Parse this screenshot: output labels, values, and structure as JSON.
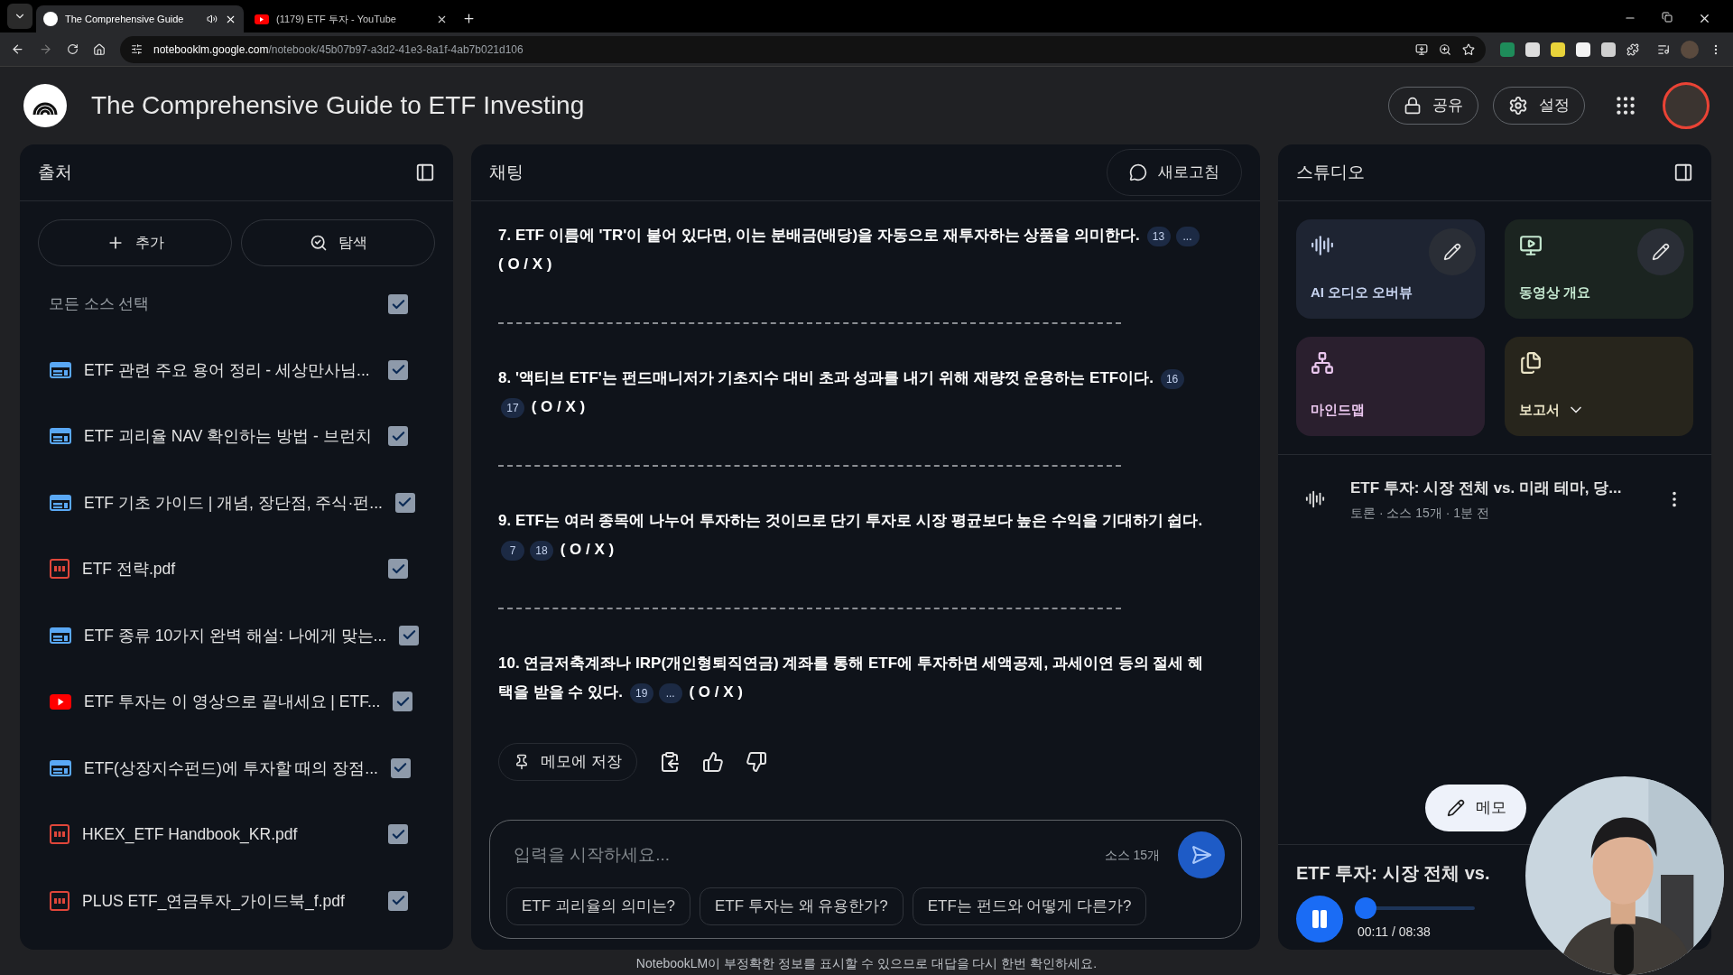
{
  "browser": {
    "tabs": [
      {
        "title": "The Comprehensive Guide",
        "kind": "notebook",
        "selected": true,
        "audio": true
      },
      {
        "title": "(1179) ETF 투자 - YouTube",
        "kind": "youtube",
        "selected": false,
        "audio": false
      }
    ],
    "address": {
      "host": "notebooklm.google.com",
      "path": "/notebook/45b07b97-a3d2-41e3-8a1f-4ab7b021d106"
    }
  },
  "header": {
    "title": "The Comprehensive Guide to ETF Investing",
    "share": "공유",
    "settings": "설정"
  },
  "sources": {
    "title": "출처",
    "add": "추가",
    "explore": "탐색",
    "select_all": {
      "label": "모든 소스 선택",
      "checked": true
    },
    "items": [
      {
        "title": "ETF 관련 주요 용어 정리 - 세상만사님...",
        "kind": "web",
        "checked": true
      },
      {
        "title": "ETF 괴리율 NAV 확인하는 방법 - 브런치",
        "kind": "web",
        "checked": true
      },
      {
        "title": "ETF 기초 가이드 | 개념, 장단점, 주식·펀...",
        "kind": "web",
        "checked": true
      },
      {
        "title": "ETF 전략.pdf",
        "kind": "pdf",
        "checked": true
      },
      {
        "title": "ETF 종류 10가지 완벽 해설: 나에게 맞는...",
        "kind": "web",
        "checked": true
      },
      {
        "title": "ETF 투자는 이 영상으로 끝내세요 | ETF...",
        "kind": "youtube",
        "checked": true
      },
      {
        "title": "ETF(상장지수펀드)에 투자할 때의 장점...",
        "kind": "web",
        "checked": true
      },
      {
        "title": "HKEX_ETF Handbook_KR.pdf",
        "kind": "pdf",
        "checked": true
      },
      {
        "title": "PLUS ETF_연금투자_가이드북_f.pdf",
        "kind": "pdf",
        "checked": true
      }
    ]
  },
  "chat": {
    "title": "채팅",
    "refresh": "새로고침",
    "questions": [
      {
        "text": "7. ETF 이름에 'TR'이 붙어 있다면, 이는 분배금(배당)을 자동으로 재투자하는 상품을 의미한다.",
        "citations": [
          "13",
          "..."
        ],
        "mark": "( O / X )"
      },
      {
        "text": "8. '액티브 ETF'는 펀드매니저가 기초지수 대비 초과 성과를 내기 위해 재량껏 운용하는 ETF이다.",
        "citations": [
          "16",
          "17"
        ],
        "mark": "( O / X )"
      },
      {
        "text": "9. ETF는 여러 종목에 나누어 투자하는 것이므로 단기 투자로 시장 평균보다 높은 수익을 기대하기 쉽다.",
        "citations": [
          "7",
          "18"
        ],
        "mark": "( O / X )"
      },
      {
        "text": "10. 연금저축계좌나 IRP(개인형퇴직연금) 계좌를 통해 ETF에 투자하면 세액공제, 과세이연 등의 절세 혜택을 받을 수 있다.",
        "citations": [
          "19",
          "..."
        ],
        "mark": "( O / X )"
      }
    ],
    "save_note": "메모에 저장",
    "input": {
      "placeholder": "입력을 시작하세요...",
      "source_count": "소스 15개"
    },
    "suggestions": [
      "ETF 괴리율의 의미는?",
      "ETF 투자는 왜 유용한가?",
      "ETF는 펀드와 어떻게 다른가?"
    ]
  },
  "studio": {
    "title": "스튜디오",
    "tiles": [
      {
        "label": "AI 오디오 오버뷰",
        "kind": "audio",
        "editable": true
      },
      {
        "label": "동영상 개요",
        "kind": "video",
        "editable": true
      },
      {
        "label": "마인드맵",
        "kind": "mindmap",
        "editable": false
      },
      {
        "label": "보고서",
        "kind": "report",
        "editable": false
      }
    ],
    "artifact": {
      "title": "ETF 투자: 시장 전체 vs. 미래 테마, 당...",
      "meta": "토론 · 소스 15개 · 1분 전"
    },
    "note_button": "메모",
    "player": {
      "title": "ETF 투자: 시장 전체 vs.",
      "time": "00:11 / 08:38",
      "playing": true,
      "level": 0.02
    }
  },
  "footer": "NotebookLM이 부정확한 정보를 표시할 수 있으므로 대답을 다시 한번 확인하세요."
}
